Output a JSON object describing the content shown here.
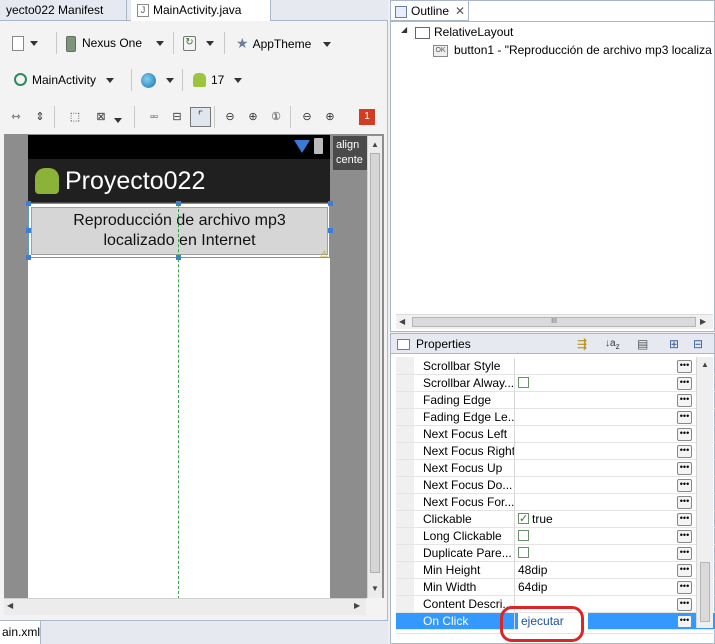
{
  "editor": {
    "tabs": [
      {
        "label": "yecto022 Manifest"
      },
      {
        "label": "MainActivity.java"
      }
    ],
    "toolbar1": {
      "device": "Nexus One",
      "theme": "AppTheme"
    },
    "toolbar2": {
      "activity": "MainActivity",
      "api_level": "17"
    },
    "error_count": "1",
    "device_preview": {
      "app_title": "Proyecto022",
      "button_text_line1": "Reproducción de archivo mp3",
      "button_text_line2": "localizado en Internet",
      "tooltip_line1": "align",
      "tooltip_line2": "cente"
    },
    "bottom_tab": "ain.xml"
  },
  "outline": {
    "title": "Outline",
    "tree": [
      {
        "label": "RelativeLayout"
      },
      {
        "label": "button1 - \"Reproducción de archivo mp3 localiza"
      }
    ]
  },
  "properties": {
    "title": "Properties",
    "rows": [
      {
        "name": "Scrollbar Style",
        "value": "",
        "check": null
      },
      {
        "name": "Scrollbar Alway...",
        "value": "",
        "check": "off"
      },
      {
        "name": "Fading Edge",
        "value": "",
        "check": null
      },
      {
        "name": "Fading Edge Le...",
        "value": "",
        "check": null
      },
      {
        "name": "Next Focus Left",
        "value": "",
        "check": null
      },
      {
        "name": "Next Focus Right",
        "value": "",
        "check": null
      },
      {
        "name": "Next Focus Up",
        "value": "",
        "check": null
      },
      {
        "name": "Next Focus Do...",
        "value": "",
        "check": null
      },
      {
        "name": "Next Focus For...",
        "value": "",
        "check": null
      },
      {
        "name": "Clickable",
        "value": "true",
        "check": "on"
      },
      {
        "name": "Long Clickable",
        "value": "",
        "check": "off"
      },
      {
        "name": "Duplicate Pare...",
        "value": "",
        "check": "off"
      },
      {
        "name": "Min Height",
        "value": "48dip",
        "check": null
      },
      {
        "name": "Min Width",
        "value": "64dip",
        "check": null
      },
      {
        "name": "Content Descri...",
        "value": "",
        "check": null
      },
      {
        "name": "On Click",
        "value": "ejecutar",
        "check": null
      }
    ]
  },
  "colors": {
    "selection": "#3399ff",
    "highlight_circle": "#d9262b"
  }
}
